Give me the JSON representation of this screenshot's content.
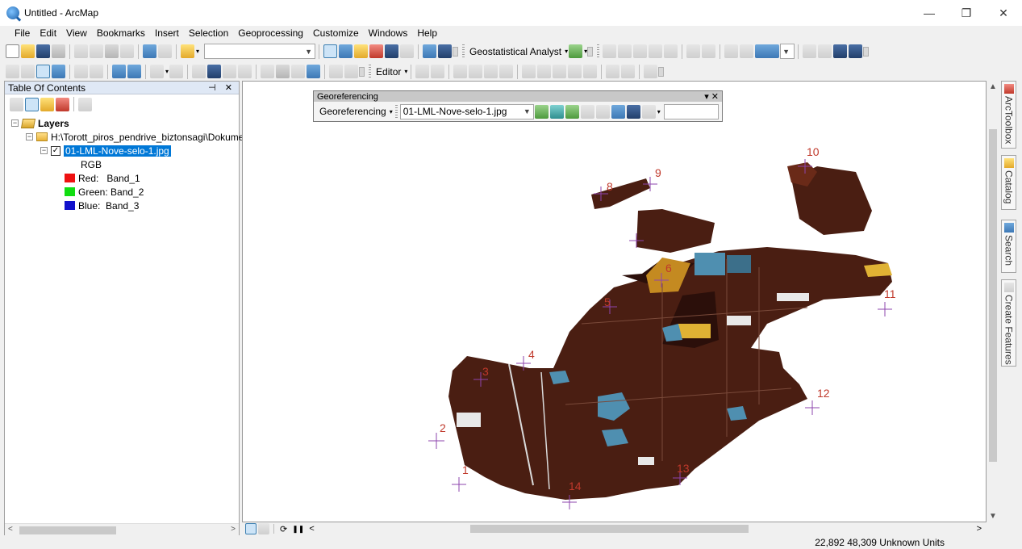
{
  "window": {
    "title": "Untitled - ArcMap",
    "controls": [
      "—",
      "❐",
      "✕"
    ]
  },
  "menu": [
    "File",
    "Edit",
    "View",
    "Bookmarks",
    "Insert",
    "Selection",
    "Geoprocessing",
    "Customize",
    "Windows",
    "Help"
  ],
  "toolbar": {
    "geostatistical_label": "Geostatistical Analyst",
    "editor_label": "Editor"
  },
  "toc": {
    "title": "Table Of Contents",
    "header_icons": "⊣ ✕",
    "root_label": "Layers",
    "folder_path": "H:\\Torott_piros_pendrive_biztonsagi\\Dokumen",
    "layer_name": "01-LML-Nove-selo-1.jpg",
    "rgb_label": "RGB",
    "bands": [
      {
        "label": "Red:   Band_1",
        "color": "#ee1111"
      },
      {
        "label": "Green: Band_2",
        "color": "#11dd11"
      },
      {
        "label": "Blue:  Band_3",
        "color": "#1111cc"
      }
    ]
  },
  "georeferencing": {
    "title": "Georeferencing",
    "menu_label": "Georeferencing",
    "layer_select": "01-LML-Nove-selo-1.jpg"
  },
  "dock_tabs": [
    "ArcToolbox",
    "Catalog",
    "Search",
    "Create Features"
  ],
  "control_points": [
    "1",
    "2",
    "3",
    "4",
    "5",
    "6",
    "8",
    "9",
    "10",
    "11",
    "12",
    "13",
    "14"
  ],
  "status": {
    "coords": "22,892  48,309 Unknown Units"
  },
  "colors": {
    "map_brown": "#4a1e12",
    "map_dark": "#2b0f0a",
    "map_blue": "#4f8fb0",
    "map_yellow": "#d8a928",
    "selection": "#0078d7"
  }
}
